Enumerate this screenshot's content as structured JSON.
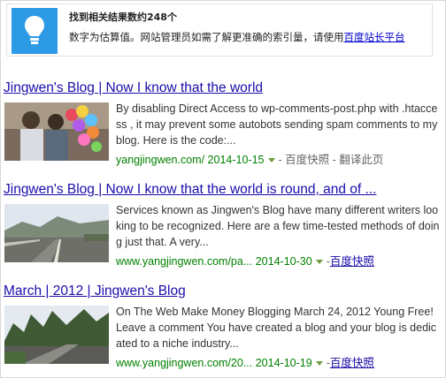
{
  "notice": {
    "title": "找到相关结果数约248个",
    "desc": "数字为估算值。网站管理员如需了解更准确的索引量，请使用",
    "link": "百度站长平台"
  },
  "results": [
    {
      "title": "Jingwen's Blog | Now I know that the world",
      "snippet": "By disabling Direct Access to wp-comments-post.php with .htaccess , it may prevent some autobots sending spam comments to my blog. Here is the code:...",
      "url": "yangjingwen.com/",
      "date": "2014-10-15",
      "cache": "百度快照",
      "translate": "翻译此页"
    },
    {
      "title": "Jingwen's Blog | Now I know that the world is round, and of ...",
      "snippet": "Services known as Jingwen's Blog have many different writers looking to be recognized. Here are a few time-tested methods of doing just that. A very...",
      "url": "www.yangjingwen.com/pa...",
      "date": "2014-10-30",
      "cache": "百度快照"
    },
    {
      "title": "March | 2012 | Jingwen's Blog",
      "snippet": "On The Web Make Money Blogging March 24, 2012 Young Free! Leave a comment You have created a blog and your blog is dedicated to a niche industry...",
      "url": "www.yangjingwen.com/20...",
      "date": "2014-10-19",
      "cache": "百度快照"
    }
  ],
  "separator": "-",
  "colors": {
    "link": "#1a0dab",
    "url": "#008000",
    "icon_bg": "#2d9ae6"
  }
}
